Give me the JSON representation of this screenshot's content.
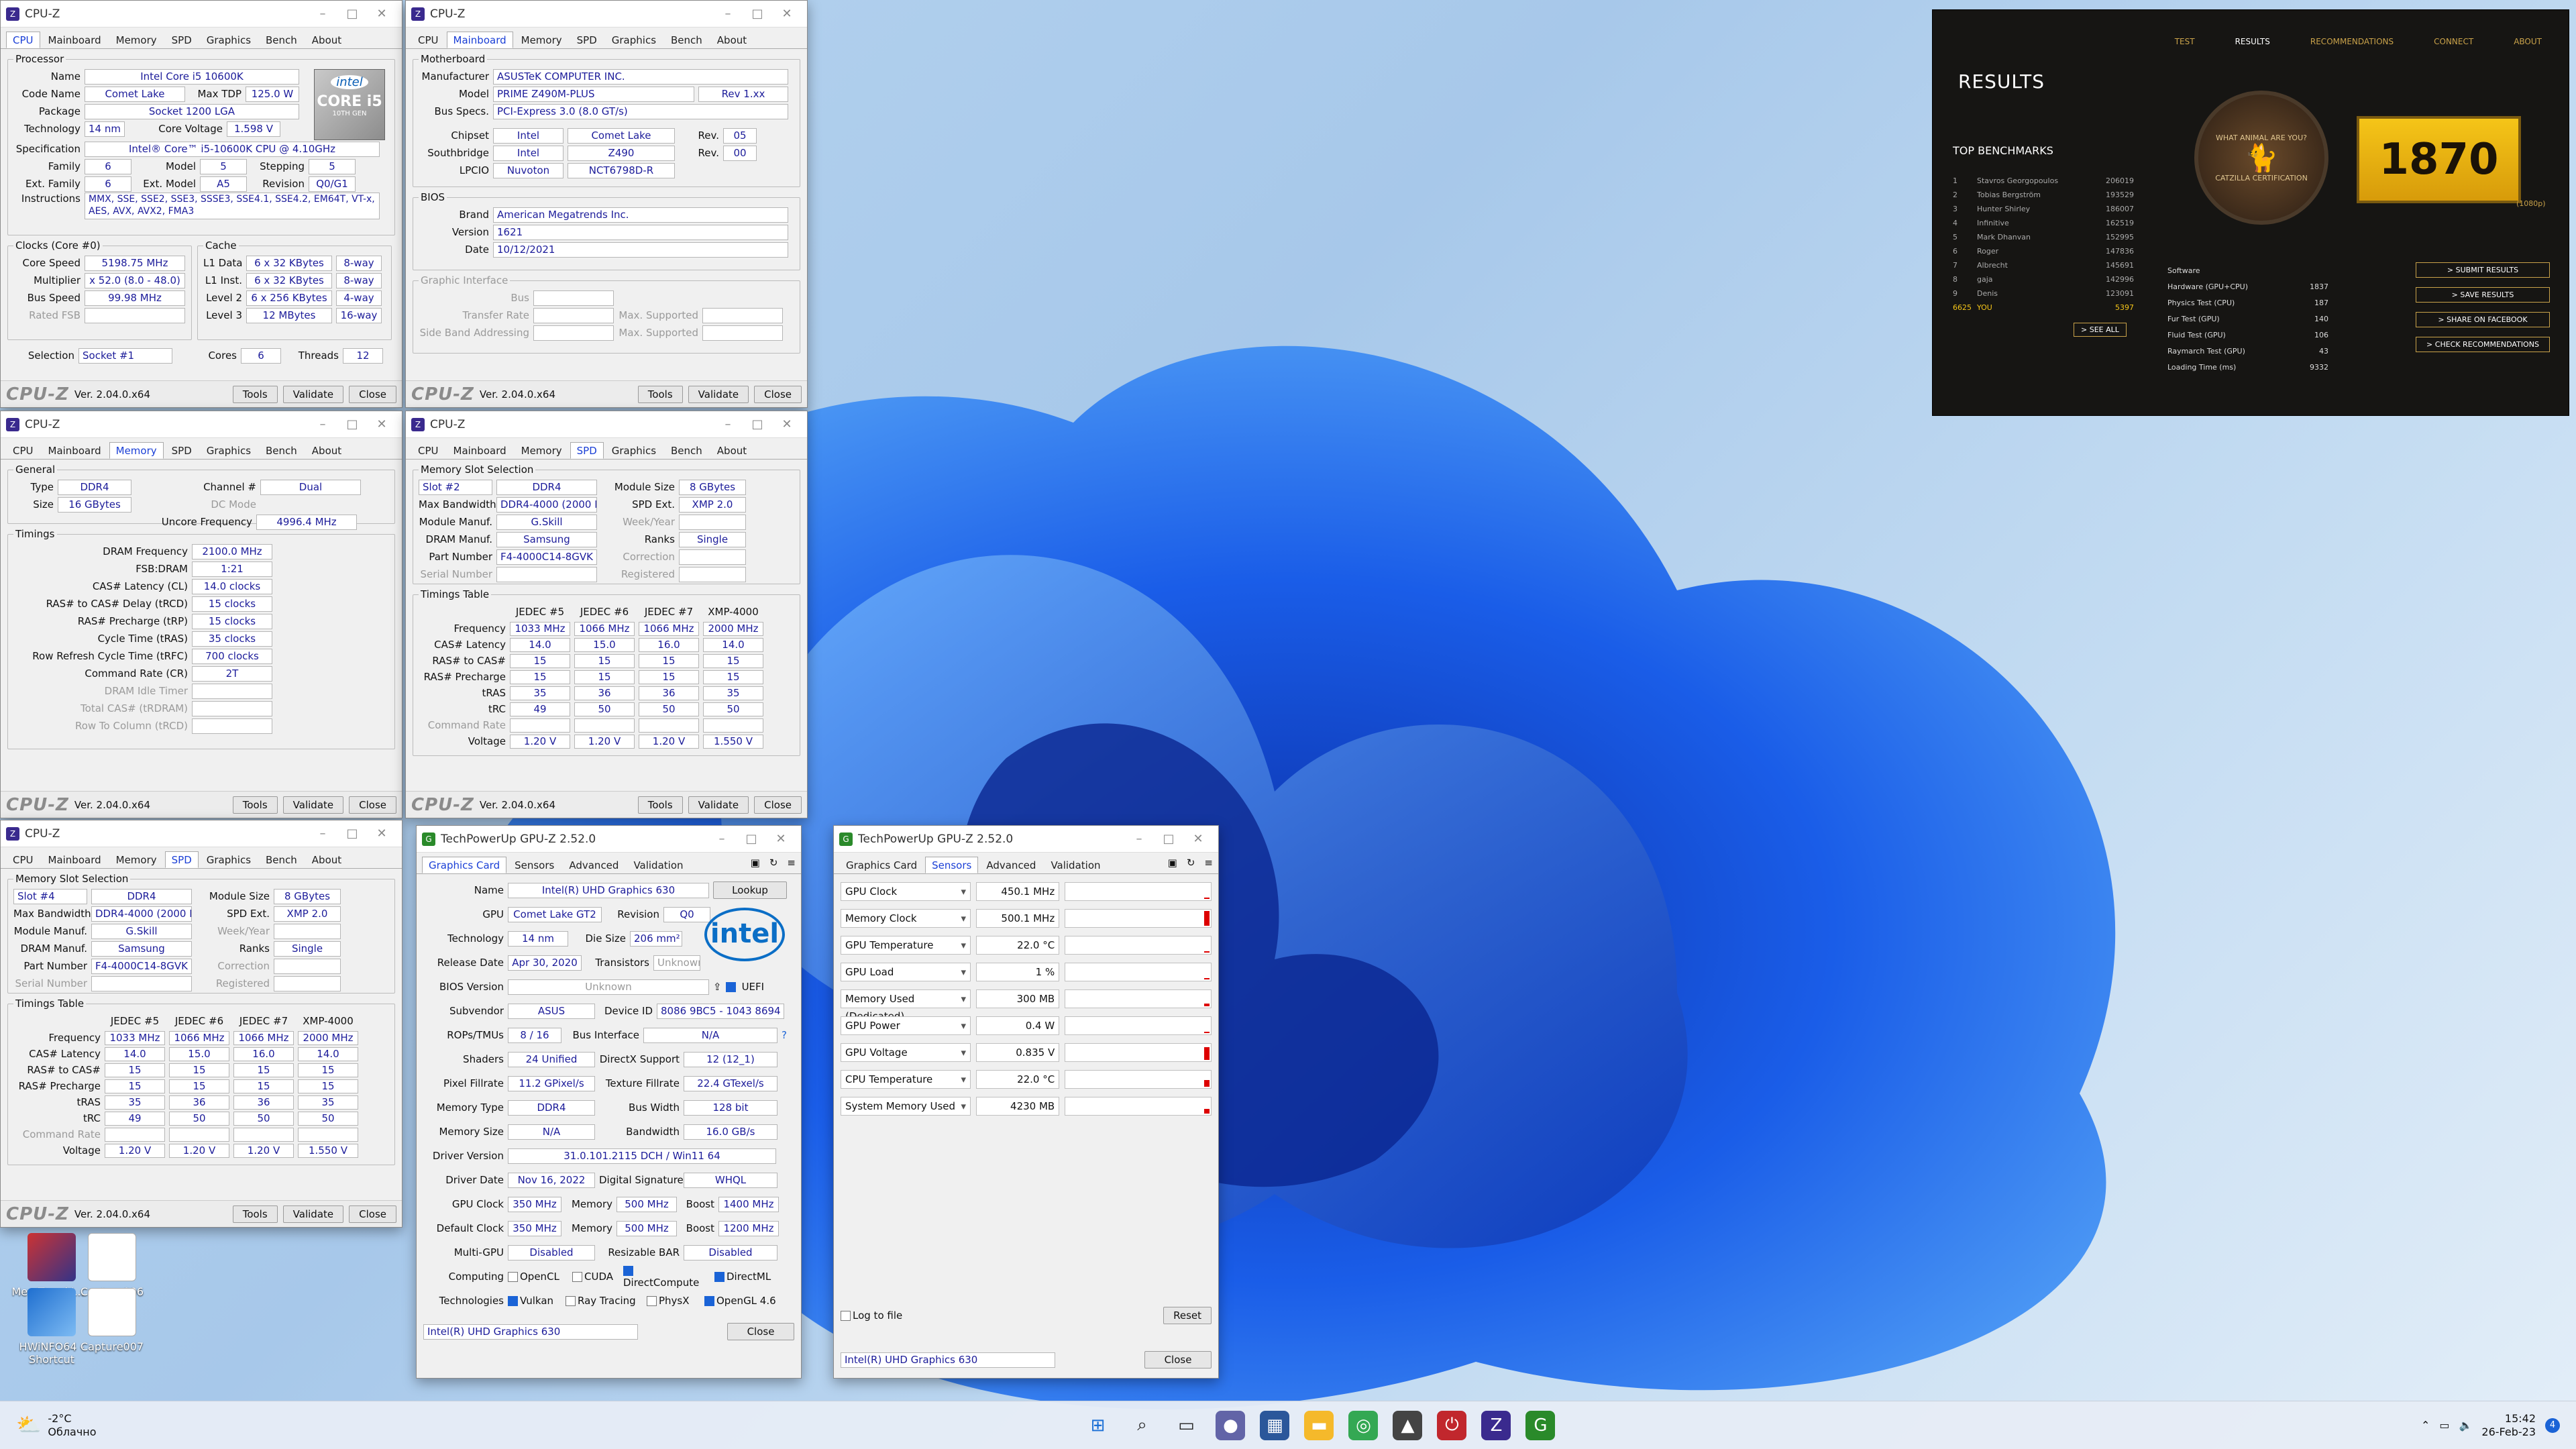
{
  "cpuz": {
    "title": "CPU-Z",
    "tabs": [
      "CPU",
      "Mainboard",
      "Memory",
      "SPD",
      "Graphics",
      "Bench",
      "About"
    ],
    "version": "Ver. 2.04.0.x64",
    "tools": "Tools",
    "validate": "Validate",
    "close": "Close",
    "logo": "CPU-Z",
    "cpu": {
      "processor_legend": "Processor",
      "name_l": "Name",
      "name": "Intel Core i5 10600K",
      "code_l": "Code Name",
      "code": "Comet Lake",
      "tdp_l": "Max TDP",
      "tdp": "125.0 W",
      "package_l": "Package",
      "package": "Socket 1200 LGA",
      "tech_l": "Technology",
      "tech": "14 nm",
      "cv_l": "Core Voltage",
      "cv": "1.598 V",
      "spec_l": "Specification",
      "spec": "Intel® Core™ i5-10600K CPU @ 4.10GHz",
      "family_l": "Family",
      "family": "6",
      "model_l": "Model",
      "model": "5",
      "step_l": "Stepping",
      "step": "5",
      "extfam_l": "Ext. Family",
      "extfam": "6",
      "extmod_l": "Ext. Model",
      "extmod": "A5",
      "rev_l": "Revision",
      "rev": "Q0/G1",
      "instr_l": "Instructions",
      "instr": "MMX, SSE, SSE2, SSE3, SSSE3, SSE4.1, SSE4.2, EM64T, VT-x, AES, AVX, AVX2, FMA3",
      "clocks_legend": "Clocks (Core #0)",
      "cache_legend": "Cache",
      "cs_l": "Core Speed",
      "cs": "5198.75 MHz",
      "mult_l": "Multiplier",
      "mult": "x 52.0 (8.0 - 48.0)",
      "bs_l": "Bus Speed",
      "bs": "99.98 MHz",
      "fsb_l": "Rated FSB",
      "l1d_l": "L1 Data",
      "l1d": "6 x 32 KBytes",
      "l1d_w": "8-way",
      "l1i_l": "L1 Inst.",
      "l1i": "6 x 32 KBytes",
      "l1i_w": "8-way",
      "l2_l": "Level 2",
      "l2": "6 x 256 KBytes",
      "l2_w": "4-way",
      "l3_l": "Level 3",
      "l3": "12 MBytes",
      "l3_w": "16-way",
      "sel_l": "Selection",
      "sel": "Socket #1",
      "cores_l": "Cores",
      "cores": "6",
      "threads_l": "Threads",
      "threads": "12",
      "badge1": "intel",
      "badge2": "CORE i5",
      "badge3": "10TH GEN"
    },
    "mb": {
      "legend": "Motherboard",
      "manu_l": "Manufacturer",
      "manu": "ASUSTeK COMPUTER INC.",
      "model_l": "Model",
      "model": "PRIME Z490M-PLUS",
      "model_rev": "Rev 1.xx",
      "bus_l": "Bus Specs.",
      "bus": "PCI-Express 3.0 (8.0 GT/s)",
      "chip_l": "Chipset",
      "chip_v": "Intel",
      "chip_n": "Comet Lake",
      "rev_l": "Rev.",
      "chip_rev": "05",
      "sb_l": "Southbridge",
      "sb_v": "Intel",
      "sb_n": "Z490",
      "sb_rev": "00",
      "lpc_l": "LPCIO",
      "lpc_v": "Nuvoton",
      "lpc_n": "NCT6798D-R",
      "bios_legend": "BIOS",
      "brand_l": "Brand",
      "brand": "American Megatrends Inc.",
      "ver_l": "Version",
      "ver": "1621",
      "date_l": "Date",
      "date": "10/12/2021",
      "gi_legend": "Graphic Interface",
      "gi_bus": "Bus",
      "gi_tr": "Transfer Rate",
      "gi_max1": "Max. Supported",
      "gi_sb": "Side Band Addressing",
      "gi_max2": "Max. Supported"
    },
    "mem": {
      "general": "General",
      "type_l": "Type",
      "type": "DDR4",
      "ch_l": "Channel #",
      "ch": "Dual",
      "size_l": "Size",
      "size": "16 GBytes",
      "dc_l": "DC Mode",
      "unc_l": "Uncore Frequency",
      "unc": "4996.4 MHz",
      "timings": "Timings",
      "rows": [
        {
          "l": "DRAM Frequency",
          "v": "2100.0 MHz"
        },
        {
          "l": "FSB:DRAM",
          "v": "1:21"
        },
        {
          "l": "CAS# Latency (CL)",
          "v": "14.0 clocks"
        },
        {
          "l": "RAS# to CAS# Delay (tRCD)",
          "v": "15 clocks"
        },
        {
          "l": "RAS# Precharge (tRP)",
          "v": "15 clocks"
        },
        {
          "l": "Cycle Time (tRAS)",
          "v": "35 clocks"
        },
        {
          "l": "Row Refresh Cycle Time (tRFC)",
          "v": "700 clocks"
        },
        {
          "l": "Command Rate (CR)",
          "v": "2T"
        }
      ],
      "dis": [
        "DRAM Idle Timer",
        "Total CAS# (tRDRAM)",
        "Row To Column (tRCD)"
      ]
    },
    "spd": {
      "legend": "Memory Slot Selection",
      "slot_a": "Slot #2",
      "slot_b": "Slot #4",
      "type": "DDR4",
      "ms_l": "Module Size",
      "ms": "8 GBytes",
      "mb_l": "Max Bandwidth",
      "mb": "DDR4-4000 (2000 MHz)",
      "ext_l": "SPD Ext.",
      "ext": "XMP 2.0",
      "mm_l": "Module Manuf.",
      "mm": "G.Skill",
      "wy_l": "Week/Year",
      "dm_l": "DRAM Manuf.",
      "dm": "Samsung",
      "rk_l": "Ranks",
      "rk": "Single",
      "pn_l": "Part Number",
      "pn": "F4-4000C14-8GVK",
      "corr_l": "Correction",
      "sn_l": "Serial Number",
      "reg_l": "Registered",
      "tt": "Timings Table",
      "cols": [
        "JEDEC #5",
        "JEDEC #6",
        "JEDEC #7",
        "XMP-4000"
      ],
      "trows": [
        {
          "l": "Frequency",
          "v": [
            "1033 MHz",
            "1066 MHz",
            "1066 MHz",
            "2000 MHz"
          ]
        },
        {
          "l": "CAS# Latency",
          "v": [
            "14.0",
            "15.0",
            "16.0",
            "14.0"
          ]
        },
        {
          "l": "RAS# to CAS#",
          "v": [
            "15",
            "15",
            "15",
            "15"
          ]
        },
        {
          "l": "RAS# Precharge",
          "v": [
            "15",
            "15",
            "15",
            "15"
          ]
        },
        {
          "l": "tRAS",
          "v": [
            "35",
            "36",
            "36",
            "35"
          ]
        },
        {
          "l": "tRC",
          "v": [
            "49",
            "50",
            "50",
            "50"
          ]
        },
        {
          "l": "Command Rate",
          "v": [
            "",
            "",
            "",
            ""
          ]
        },
        {
          "l": "Voltage",
          "v": [
            "1.20 V",
            "1.20 V",
            "1.20 V",
            "1.550 V"
          ]
        }
      ]
    }
  },
  "gpuz": {
    "title": "TechPowerUp GPU-Z 2.52.0",
    "tabs": [
      "Graphics Card",
      "Sensors",
      "Advanced",
      "Validation"
    ],
    "name_l": "Name",
    "name": "Intel(R) UHD Graphics 630",
    "lookup": "Lookup",
    "gpu_l": "GPU",
    "gpu": "Comet Lake GT2",
    "rev_l": "Revision",
    "rev": "Q0",
    "tech_l": "Technology",
    "tech": "14 nm",
    "die_l": "Die Size",
    "die": "206 mm²",
    "rd_l": "Release Date",
    "rd": "Apr 30, 2020",
    "tr_l": "Transistors",
    "tr": "Unknown",
    "bios_l": "BIOS Version",
    "bios": "Unknown",
    "uefi": "UEFI",
    "sub_l": "Subvendor",
    "sub": "ASUS",
    "did_l": "Device ID",
    "did": "8086 9BC5 - 1043 8694",
    "rop_l": "ROPs/TMUs",
    "rop": "8 / 16",
    "bi_l": "Bus Interface",
    "bi": "N/A",
    "sh_l": "Shaders",
    "sh": "24 Unified",
    "dx_l": "DirectX Support",
    "dx": "12 (12_1)",
    "pf_l": "Pixel Fillrate",
    "pf": "11.2 GPixel/s",
    "tf_l": "Texture Fillrate",
    "tf": "22.4 GTexel/s",
    "mt_l": "Memory Type",
    "mt": "DDR4",
    "bw_l": "Bus Width",
    "bw": "128 bit",
    "ms_l": "Memory Size",
    "ms": "N/A",
    "band_l": "Bandwidth",
    "band": "16.0 GB/s",
    "dv_l": "Driver Version",
    "dv": "31.0.101.2115 DCH / Win11 64",
    "dd_l": "Driver Date",
    "dd": "Nov 16, 2022",
    "ds_l": "Digital Signature",
    "ds": "WHQL",
    "gc_l": "GPU Clock",
    "gc": "350 MHz",
    "mem_l": "Memory",
    "gm": "500 MHz",
    "boost_l": "Boost",
    "gb": "1400 MHz",
    "dc_l": "Default Clock",
    "dcc": "350 MHz",
    "dm": "500 MHz",
    "db": "1200 MHz",
    "mg_l": "Multi-GPU",
    "mg": "Disabled",
    "rb_l": "Resizable BAR",
    "rb": "Disabled",
    "comp_l": "Computing",
    "opencl": "OpenCL",
    "cuda": "CUDA",
    "dcomp": "DirectCompute",
    "dml": "DirectML",
    "techs_l": "Technologies",
    "vulkan": "Vulkan",
    "rt": "Ray Tracing",
    "physx": "PhysX",
    "ogl": "OpenGL 4.6",
    "sel": "Intel(R) UHD Graphics 630",
    "close": "Close",
    "intel": "intel",
    "sensors": [
      {
        "n": "GPU Clock",
        "v": "450.1 MHz",
        "lvl": 0.1
      },
      {
        "n": "Memory Clock",
        "v": "500.1 MHz",
        "lvl": 0.9
      },
      {
        "n": "GPU Temperature",
        "v": "22.0 °C",
        "lvl": 0.1
      },
      {
        "n": "GPU Load",
        "v": "1 %",
        "lvl": 0.05
      },
      {
        "n": "Memory Used (Dedicated)",
        "v": "300 MB",
        "lvl": 0.15
      },
      {
        "n": "GPU Power",
        "v": "0.4 W",
        "lvl": 0.1
      },
      {
        "n": "GPU Voltage",
        "v": "0.835 V",
        "lvl": 0.8
      },
      {
        "n": "CPU Temperature",
        "v": "22.0 °C",
        "lvl": 0.4
      },
      {
        "n": "System Memory Used",
        "v": "4230 MB",
        "lvl": 0.3
      }
    ],
    "log": "Log to file",
    "reset": "Reset"
  },
  "results": {
    "nav": [
      "TEST",
      "RESULTS",
      "RECOMMENDATIONS",
      "CONNECT",
      "ABOUT"
    ],
    "title": "RESULTS",
    "top": "TOP BENCHMARKS",
    "score": "1870",
    "res": "(1080p)",
    "board": [
      {
        "r": "1",
        "n": "Stavros Georgopoulos",
        "s": "206019"
      },
      {
        "r": "2",
        "n": "Tobias Bergström",
        "s": "193529"
      },
      {
        "r": "3",
        "n": "Hunter Shirley",
        "s": "186007"
      },
      {
        "r": "4",
        "n": "Infinitive",
        "s": "162519"
      },
      {
        "r": "5",
        "n": "Mark Dhanvan",
        "s": "152995"
      },
      {
        "r": "6",
        "n": "Roger",
        "s": "147836"
      },
      {
        "r": "7",
        "n": "Albrecht",
        "s": "145691"
      },
      {
        "r": "8",
        "n": "gaja",
        "s": "142996"
      },
      {
        "r": "9",
        "n": "Denis",
        "s": "123091"
      },
      {
        "r": "6625",
        "n": "YOU",
        "s": "5397"
      }
    ],
    "see_all": "> SEE ALL",
    "stats": [
      {
        "l": "Software",
        "v": ""
      },
      {
        "l": "Hardware (GPU+CPU)",
        "v": "1837"
      },
      {
        "l": "Physics Test (CPU)",
        "v": "187"
      },
      {
        "l": "Fur Test (GPU)",
        "v": "140"
      },
      {
        "l": "Fluid Test (GPU)",
        "v": "106"
      },
      {
        "l": "Raymarch Test (GPU)",
        "v": "43"
      },
      {
        "l": "Loading Time (ms)",
        "v": "9332"
      }
    ],
    "btns": [
      "> SUBMIT RESULTS",
      "> SAVE RESULTS",
      "> SHARE ON FACEBOOK",
      "> CHECK RECOMMENDATIONS"
    ],
    "cert": "CATZILLA CERTIFICATION",
    "cert_top": "WHAT ANIMAL ARE YOU?"
  },
  "desktop": [
    {
      "n": "MemTweakI... - Shortcut"
    },
    {
      "n": "Capture006"
    },
    {
      "n": "HWiNFO64 - Shortcut"
    },
    {
      "n": "Capture007"
    }
  ],
  "taskbar": {
    "temp": "-2°C",
    "cond": "Облачно",
    "time": "15:42",
    "date": "26-Feb-23",
    "notif": "4"
  }
}
